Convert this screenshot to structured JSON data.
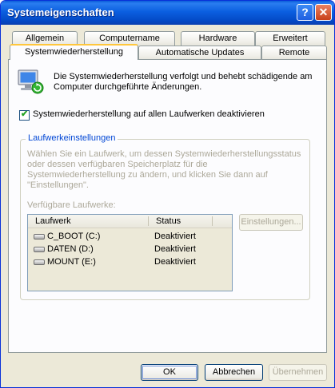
{
  "window": {
    "title": "Systemeigenschaften"
  },
  "titlebar_buttons": {
    "help": "?",
    "close": "✕"
  },
  "tabs": {
    "row1": [
      "Allgemein",
      "Computername",
      "Hardware",
      "Erweitert"
    ],
    "row2": [
      "Systemwiederherstellung",
      "Automatische Updates",
      "Remote"
    ],
    "active": "Systemwiederherstellung"
  },
  "intro": {
    "icon": "system-restore-icon",
    "text": "Die Systemwiederherstellung verfolgt und behebt schädigende am Computer durchgeführte Änderungen."
  },
  "disable_all": {
    "label": "Systemwiederherstellung auf allen Laufwerken deaktivieren",
    "checked": true
  },
  "drive_settings": {
    "legend": "Laufwerkeinstellungen",
    "description": "Wählen Sie ein Laufwerk, um dessen Systemwiederherstellungsstatus oder dessen verfügbaren Speicherplatz für die Systemwiederherstellung zu ändern, und klicken Sie dann auf \"Einstellungen\".",
    "available_label": "Verfügbare Laufwerke:",
    "columns": [
      "Laufwerk",
      "Status"
    ],
    "drives": [
      {
        "name": "C_BOOT (C:)",
        "status": "Deaktiviert",
        "icon": "hard-drive-icon"
      },
      {
        "name": "DATEN (D:)",
        "status": "Deaktiviert",
        "icon": "hard-drive-icon"
      },
      {
        "name": "MOUNT (E:)",
        "status": "Deaktiviert",
        "icon": "hard-drive-icon"
      }
    ],
    "settings_button": "Einstellungen..."
  },
  "buttons": {
    "ok": "OK",
    "cancel": "Abbrechen",
    "apply": "Übernehmen"
  },
  "colors": {
    "titlebar": "#0a5bd8",
    "group_legend": "#0046d5",
    "disabled_text": "#aca899",
    "active_tab_accent": "#ffc73c"
  }
}
